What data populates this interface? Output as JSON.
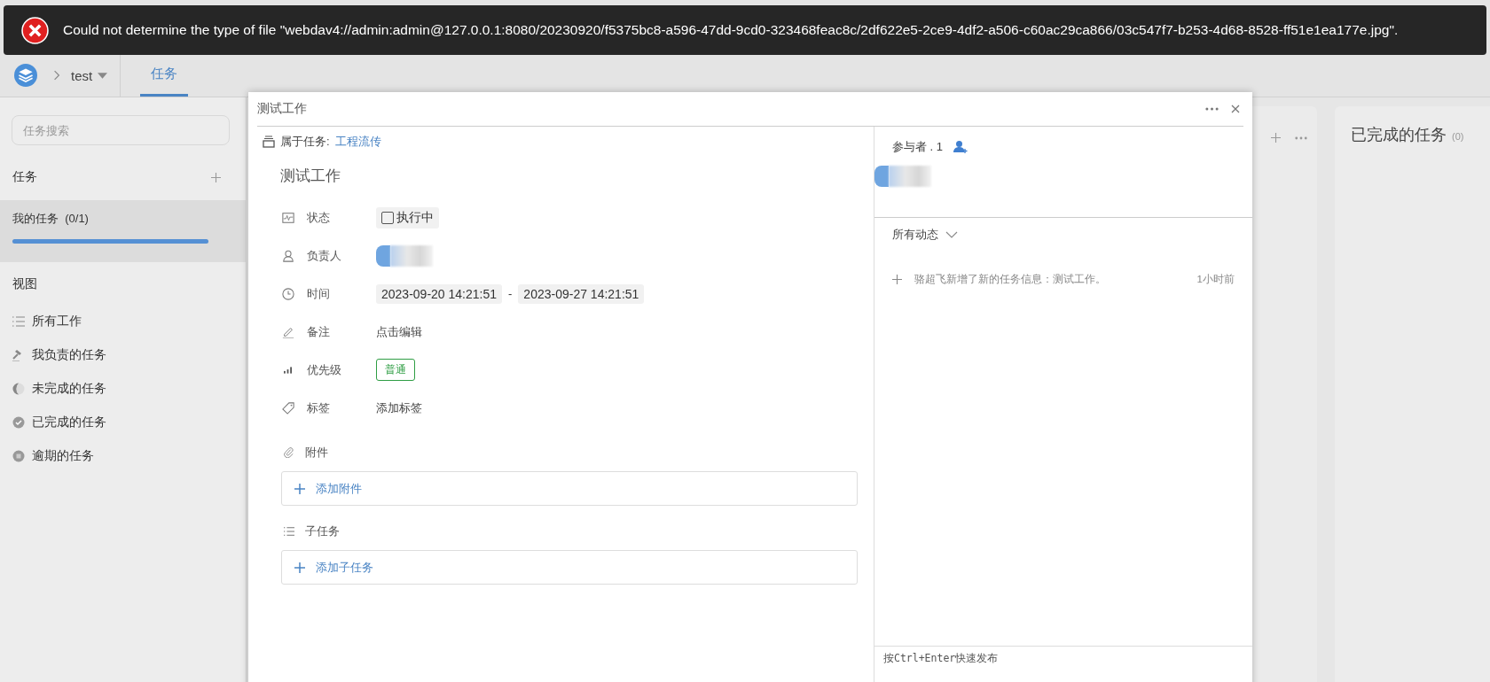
{
  "toast": {
    "message": "Could not determine the type of file \"webdav4://admin:admin@127.0.0.1:8080/20230920/f5375bc8-a596-47dd-9cd0-323468feac8c/2df622e5-2ce9-4df2-a506-c60ac29ca866/03c547f7-b253-4d68-8528-ff51e1ea177e.jpg\"."
  },
  "header": {
    "project": "test",
    "tabs": [
      {
        "label": "任务",
        "selected": true
      }
    ]
  },
  "sidebar": {
    "search": {
      "placeholder": "任务搜索"
    },
    "section_title": "任务",
    "task_lists": [
      {
        "label": "我的任务",
        "count": "(0/1)",
        "selected": true,
        "level": 1
      }
    ],
    "views_title": "视图",
    "views": [
      {
        "label": "所有工作",
        "kind": "list"
      },
      {
        "label": "我负责的任务",
        "kind": "hammer"
      },
      {
        "label": "未完成的任务",
        "kind": "half"
      },
      {
        "label": "已完成的任务",
        "kind": "done"
      },
      {
        "label": "逾期的任务",
        "kind": "overdue"
      }
    ]
  },
  "board": {
    "columns": [
      {
        "title": "已完成的任务",
        "count": "(0)"
      }
    ]
  },
  "dialog": {
    "title": "测试工作",
    "parent_label": "属于任务:",
    "parent_link": "工程流传",
    "task_title": "测试工作",
    "fields": [
      {
        "kind": "status",
        "label": "状态",
        "value": "执行中",
        "checked": false
      },
      {
        "kind": "assignee",
        "label": "负责人"
      },
      {
        "kind": "time",
        "label": "时间",
        "start": "2023-09-20 14:21:51",
        "separator": "-",
        "end": "2023-09-27 14:21:51"
      },
      {
        "kind": "note",
        "label": "备注",
        "value": "点击编辑"
      },
      {
        "kind": "priority",
        "label": "优先级",
        "value": "普通"
      },
      {
        "kind": "tags",
        "label": "标签",
        "value": "添加标签"
      }
    ],
    "sections": [
      {
        "kind": "attachment",
        "label": "附件",
        "button": "添加附件"
      },
      {
        "kind": "subtask",
        "label": "子任务",
        "button": "添加子任务"
      }
    ],
    "participants_label": "参与者 . 1",
    "activity_filter": "所有动态",
    "activities": [
      {
        "text": "骆超飞新增了新的任务信息：测试工作。",
        "time": "1小时前"
      }
    ],
    "footer_hint": "按Ctrl+Enter快速发布"
  }
}
